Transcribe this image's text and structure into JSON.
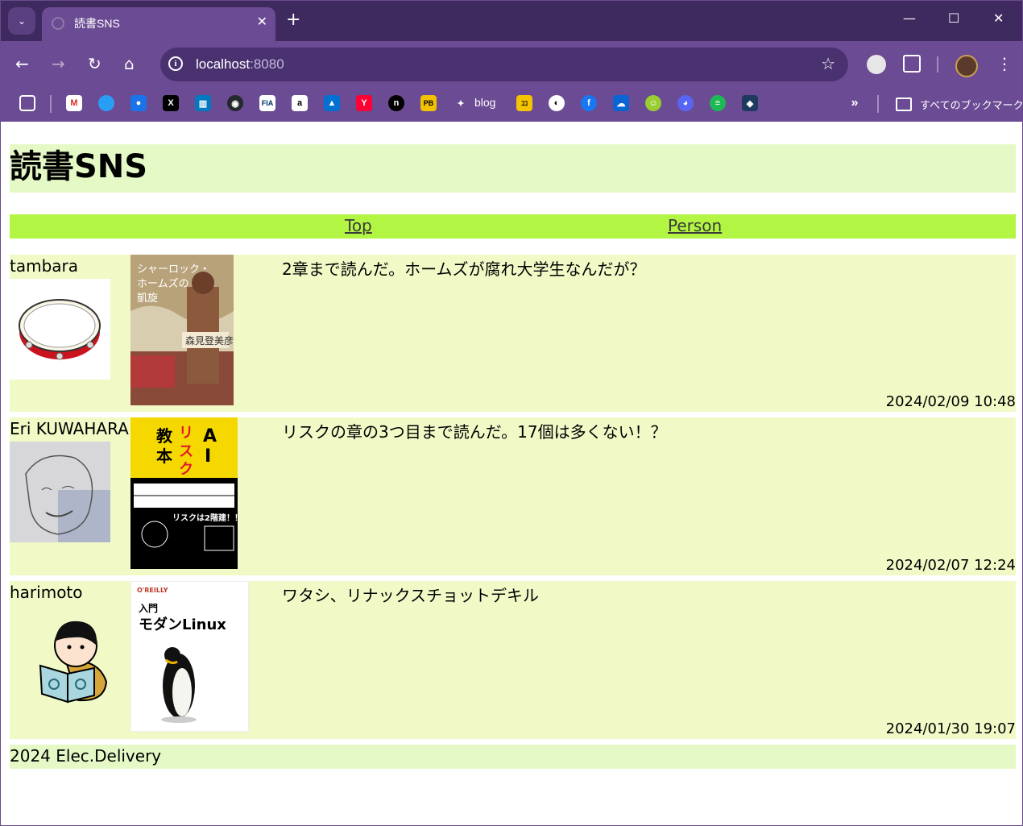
{
  "browser": {
    "tab_title": "読書SNS",
    "url_host": "localhost",
    "url_port": ":8080",
    "bookmarks_blog": "blog",
    "all_bookmarks": "すべてのブックマーク"
  },
  "site": {
    "title": "読書SNS",
    "nav": {
      "top": "Top",
      "person": "Person"
    },
    "footer": "2024 Elec.Delivery"
  },
  "posts": [
    {
      "user": "tambara",
      "comment": "2章まで読んだ。ホームズが腐れ大学生なんだが？",
      "date": "2024/02/09 10:48",
      "cover_title": "シャーロック・ホームズの凱旋",
      "cover_author": "森見登美彦"
    },
    {
      "user": "Eri KUWAHARA",
      "comment": "リスクの章の3つ目まで読んだ。17個は多くない！？",
      "date": "2024/02/07 12:24",
      "cover_title_main": "AIリスク教本",
      "cover_banner": "リスクは2階建！！"
    },
    {
      "user": "harimoto",
      "comment": "ワタシ、リナックスチョットデキル",
      "date": "2024/01/30 19:07",
      "cover_publisher": "O'REILLY",
      "cover_title1": "入門",
      "cover_title2": "モダンLinux"
    }
  ],
  "colors": {
    "header_bg": "#e5f9c6",
    "nav_bg": "#b2f542",
    "post_bg": "#f1fac7",
    "browser_chrome": "#6b4b93"
  }
}
